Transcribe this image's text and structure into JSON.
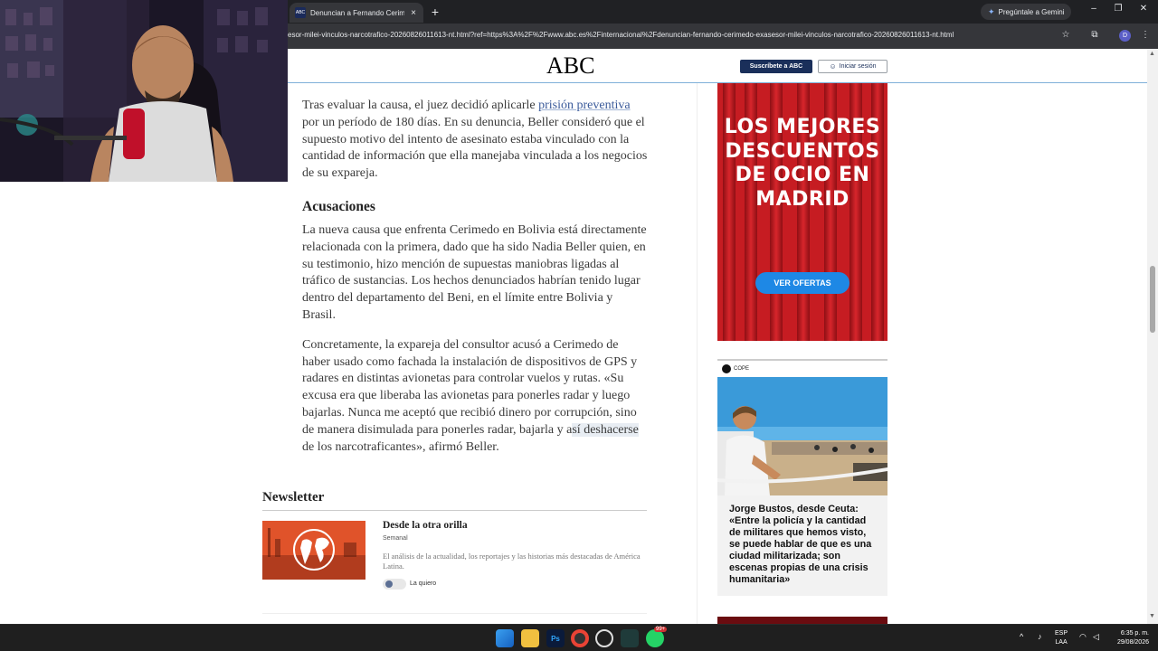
{
  "browser": {
    "tab_title": "Denuncian a Fernando Cerimedo",
    "new_tab": "+",
    "gemini_label": "Pregúntale a Gemini",
    "url": "esor-milei-vinculos-narcotrafico-20260826011613-nt.html?ref=https%3A%2F%2Fwww.abc.es%2Finternacional%2Fdenuncian-fernando-cerimedo-exasesor-milei-vinculos-narcotrafico-20260826011613-nt.html",
    "profile_initial": "D"
  },
  "site": {
    "logo": "ABC",
    "subscribe": "Suscríbete a ABC",
    "login": "Iniciar sesión"
  },
  "article": {
    "p1_before": "Tras evaluar la causa, el juez decidió aplicarle ",
    "p1_link": "prisión preventiva",
    "p1_after": " por un período de 180 días. En su denuncia, Beller consideró que el supuesto motivo del intento de asesinato estaba vinculado con la cantidad de información que ella manejaba vinculada a los negocios de su expareja.",
    "h2": "Acusaciones",
    "p2": "La nueva causa que enfrenta Cerimedo en Bolivia está directamente relacionada con la primera, dado que ha sido Nadia Beller quien, en su testimonio, hizo mención de supuestas maniobras ligadas al tráfico de sustancias. Los hechos denunciados habrían tenido lugar dentro del departamento del Beni, en el límite entre Bolivia y Brasil.",
    "p3_before": "Concretamente, la expareja del consultor acusó a Cerimedo de haber usado como fachada la instalación de dispositivos de GPS y radares en distintas avionetas para controlar vuelos y rutas. «Su excusa era que liberaba las avionetas para ponerles radar y luego bajarlas. Nunca me aceptó que recibió dinero por corrupción, sino de manera disimulada para ponerles radar, bajarla y a",
    "p3_hl": "sí deshacerse",
    "p3_after": " de los narcotraficantes», afirmó Beller."
  },
  "newsletter": {
    "heading": "Newsletter",
    "title": "Desde la otra orilla",
    "frequency": "Semanal",
    "description": "El análisis de la actualidad, los reportajes y las historias más destacadas de América Latina.",
    "toggle_label": "La quiero"
  },
  "ad": {
    "text": "LOS MEJORES DESCUENTOS DE OCIO EN MADRID",
    "button": "VER OFERTAS"
  },
  "cope": {
    "source": "COPE",
    "caption": "Jorge Bustos, desde Ceuta: «Entre la policía y la cantidad de militares que hemos visto, se puede hablar de que es una ciudad militarizada; son escenas propias de una crisis humanitaria»"
  },
  "taskbar": {
    "lang_top": "ESP",
    "lang_bottom": "LAA",
    "time": "6:35 p. m.",
    "date": "29/08/2026",
    "badge": "99+"
  }
}
